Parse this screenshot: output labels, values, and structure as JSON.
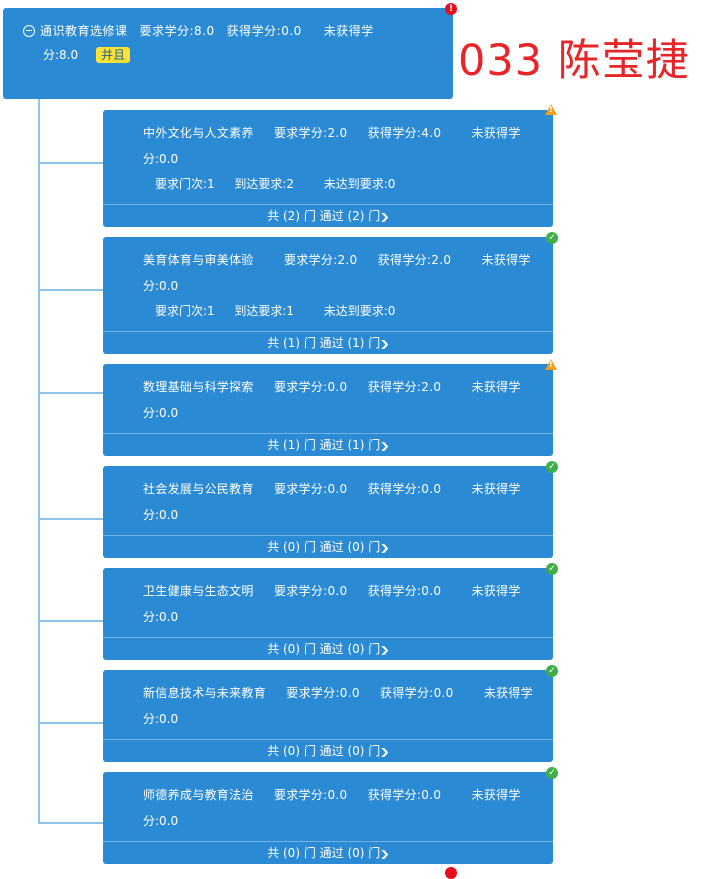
{
  "root": {
    "name": "通识教育选修课",
    "req_label": "要求学分:8.0",
    "got_label": "获得学分:0.0",
    "miss_label_1": "未获得学",
    "miss_label_2": "分:8.0",
    "logic_badge": "并且",
    "status": "error"
  },
  "watermark": "033 陈莹捷",
  "children": [
    {
      "name": "中外文化与人文素养",
      "req": "要求学分:2.0",
      "got": "获得学分:4.0",
      "miss1": "未获得学",
      "miss2": "分:0.0",
      "count_req": "要求门次:1",
      "count_reach": "到达要求:2",
      "count_miss": "未达到要求:0",
      "footer": "共 (2) 门 通过 (2) 门",
      "status": "warning"
    },
    {
      "name": "美育体育与审美体验",
      "req": "要求学分:2.0",
      "got": "获得学分:2.0",
      "miss1": "未获得学",
      "miss2": "分:0.0",
      "count_req": "要求门次:1",
      "count_reach": "到达要求:1",
      "count_miss": "未达到要求:0",
      "footer": "共 (1) 门 通过 (1) 门",
      "status": "ok"
    },
    {
      "name": "数理基础与科学探索",
      "req": "要求学分:0.0",
      "got": "获得学分:2.0",
      "miss1": "未获得学",
      "miss2": "分:0.0",
      "footer": "共 (1) 门 通过 (1) 门",
      "status": "warning"
    },
    {
      "name": "社会发展与公民教育",
      "req": "要求学分:0.0",
      "got": "获得学分:0.0",
      "miss1": "未获得学",
      "miss2": "分:0.0",
      "footer": "共 (0) 门 通过 (0) 门",
      "status": "ok"
    },
    {
      "name": "卫生健康与生态文明",
      "req": "要求学分:0.0",
      "got": "获得学分:0.0",
      "miss1": "未获得学",
      "miss2": "分:0.0",
      "footer": "共 (0) 门 通过 (0) 门",
      "status": "ok"
    },
    {
      "name": "新信息技术与未来教育",
      "req": "要求学分:0.0",
      "got": "获得学分:0.0",
      "miss1": "未获得学",
      "miss2": "分:0.0",
      "footer": "共 (0) 门 通过 (0) 门",
      "status": "ok"
    },
    {
      "name": "师德养成与教育法治",
      "req": "要求学分:0.0",
      "got": "获得学分:0.0",
      "miss1": "未获得学",
      "miss2": "分:0.0",
      "footer": "共 (0) 门 通过 (0) 门",
      "status": "ok"
    }
  ],
  "colors": {
    "card": "#2b8ad4",
    "tree_line": "#8ec3ec",
    "ok": "#3fae49",
    "warning": "#f0a018",
    "error": "#e4101c",
    "badge": "#ffe133",
    "watermark": "#e7262a"
  },
  "icons": {
    "collapse": "minus-circle-icon",
    "expand_footer": "chevron-down-icon",
    "ok": "check-circle-icon",
    "warning": "warning-triangle-icon",
    "error": "exclamation-circle-icon"
  }
}
